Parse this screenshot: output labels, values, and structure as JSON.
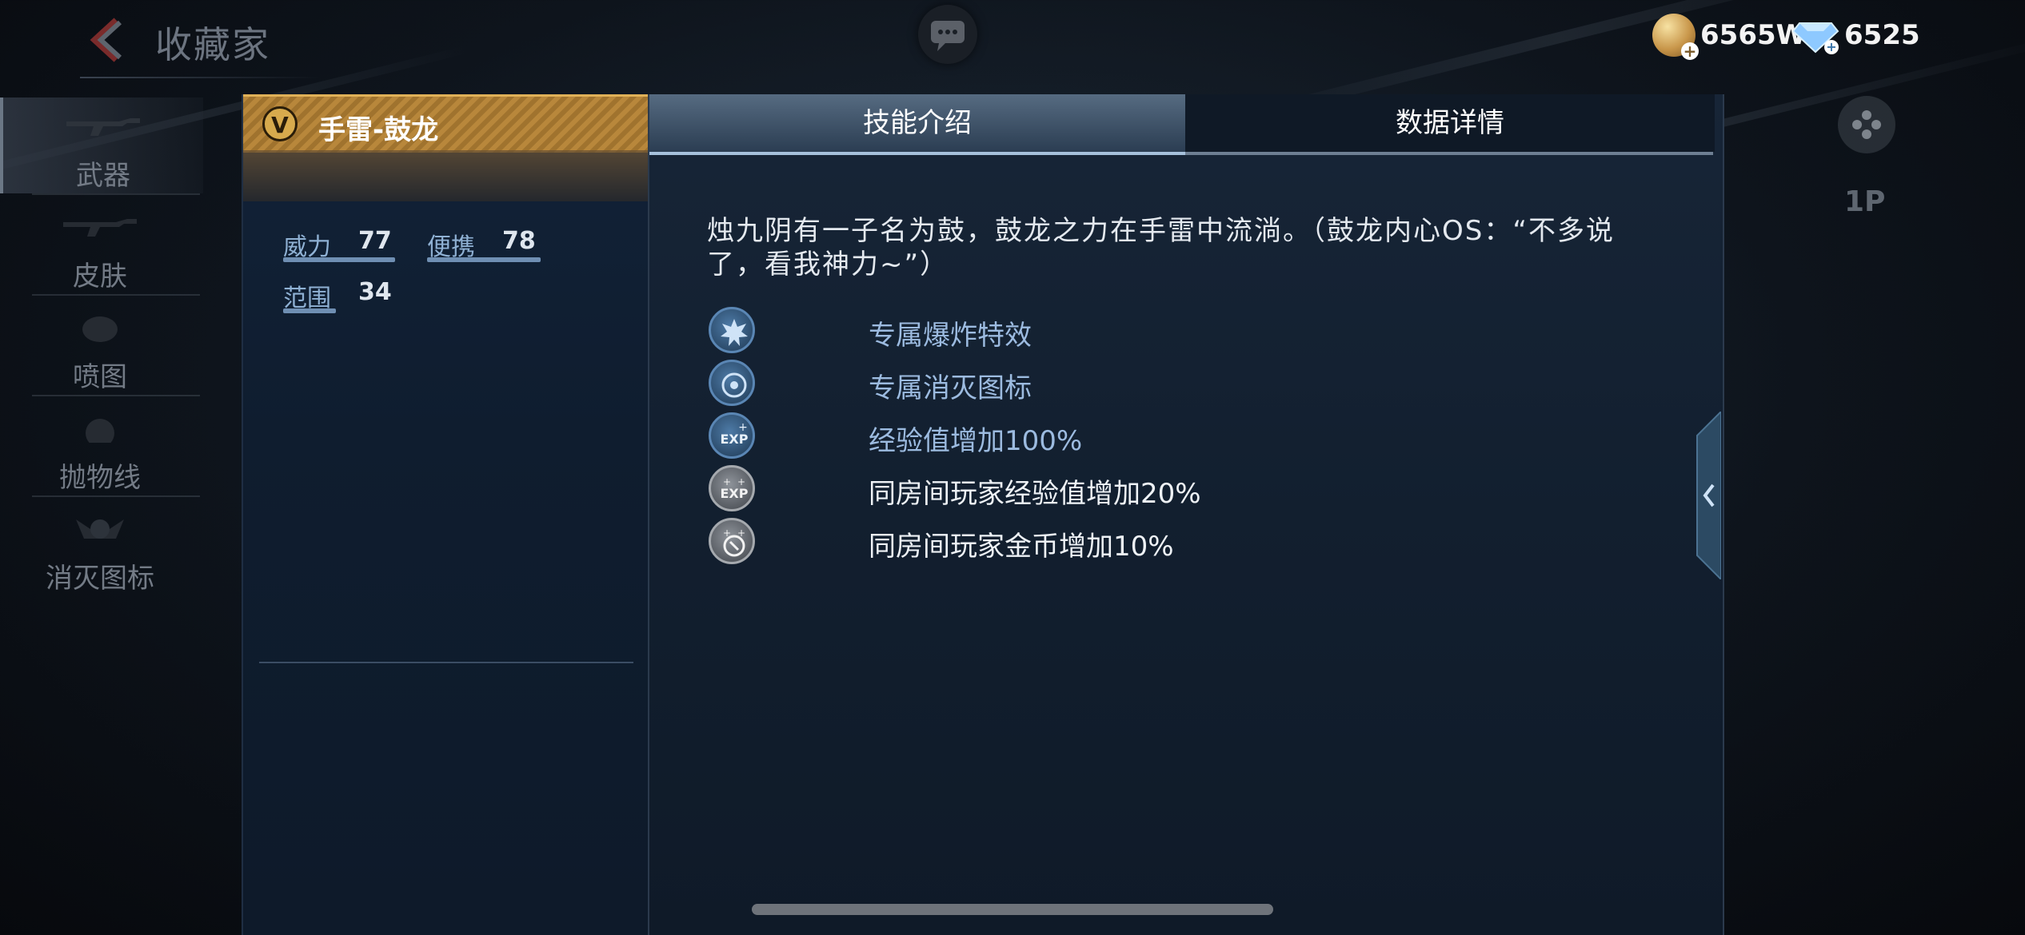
{
  "header": {
    "title": "收藏家",
    "currencies": [
      {
        "name": "gold-coin",
        "value": "6565W"
      },
      {
        "name": "diamond",
        "value": "6525"
      }
    ]
  },
  "sidebar": {
    "items": [
      {
        "label": "武器",
        "active": true
      },
      {
        "label": "皮肤",
        "active": false
      },
      {
        "label": "喷图",
        "active": false
      },
      {
        "label": "抛物线",
        "active": false
      },
      {
        "label": "消灭图标",
        "active": false
      }
    ]
  },
  "right_rail": {
    "player_indicator": "1P"
  },
  "item_panel": {
    "quality_badge": "V",
    "name": "手雷-鼓龙",
    "stats": [
      {
        "label": "威力",
        "value": "77"
      },
      {
        "label": "便携",
        "value": "78"
      },
      {
        "label": "范围",
        "value": "34"
      }
    ]
  },
  "detail_panel": {
    "tabs": [
      {
        "label": "技能介绍",
        "active": true
      },
      {
        "label": "数据详情",
        "active": false
      }
    ],
    "description_line1": "烛九阴有一子名为鼓，鼓龙之力在手雷中流淌。（鼓龙内心OS：“不多说",
    "description_line2": "了，看我神力~”）",
    "features": [
      {
        "icon": "explosion-icon",
        "label": "专属爆炸特效",
        "color": "#9cbbe0"
      },
      {
        "icon": "kill-badge-icon",
        "label": "专属消灭图标",
        "color": "#9cbbe0"
      },
      {
        "icon": "exp-boost-icon",
        "label": "经验值增加100%",
        "color": "#9cbbe0"
      },
      {
        "icon": "room-exp-icon",
        "label": "同房间玩家经验值增加20%",
        "color": "#eef2f6"
      },
      {
        "icon": "room-gold-icon",
        "label": "同房间玩家金币增加10%",
        "color": "#eef2f6"
      }
    ]
  },
  "colors": {
    "gold_header": "#b8873b",
    "active_tab": "#566b81",
    "feature_blue": "#9cbbe0"
  }
}
